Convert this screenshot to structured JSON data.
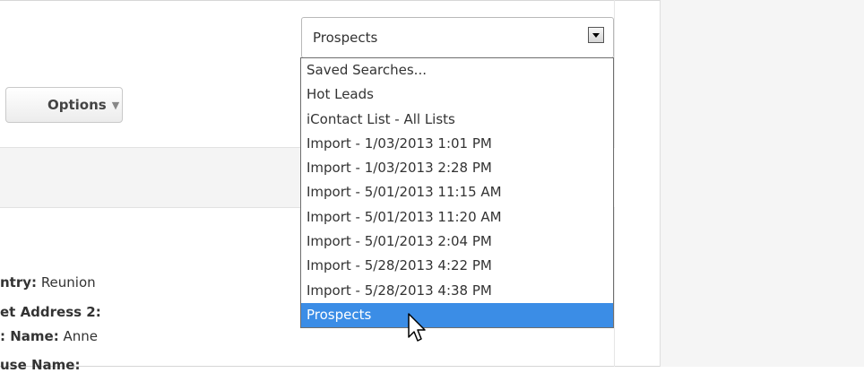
{
  "select": {
    "value": "Prospects",
    "options": [
      "Saved Searches...",
      "Hot Leads",
      "iContact List - All Lists",
      "Import - 1/03/2013 1:01 PM",
      "Import - 1/03/2013 2:28 PM",
      "Import - 5/01/2013 11:15 AM",
      "Import - 5/01/2013 11:20 AM",
      "Import - 5/01/2013 2:04 PM",
      "Import - 5/28/2013 4:22 PM",
      "Import - 5/28/2013 4:38 PM",
      "Prospects"
    ],
    "highlighted_index": 10
  },
  "toolbar": {
    "options_label": "Options",
    "options_caret": "▼"
  },
  "fields": [
    {
      "label": "ntry:",
      "value": "Reunion"
    },
    {
      "label": "et Address 2:",
      "value": ""
    },
    {
      "label": ": Name:",
      "value": "Anne"
    },
    {
      "label": "use Name:",
      "value": ""
    }
  ],
  "colors": {
    "highlight": "#3b8de6",
    "panel": "#f5f5f5"
  }
}
